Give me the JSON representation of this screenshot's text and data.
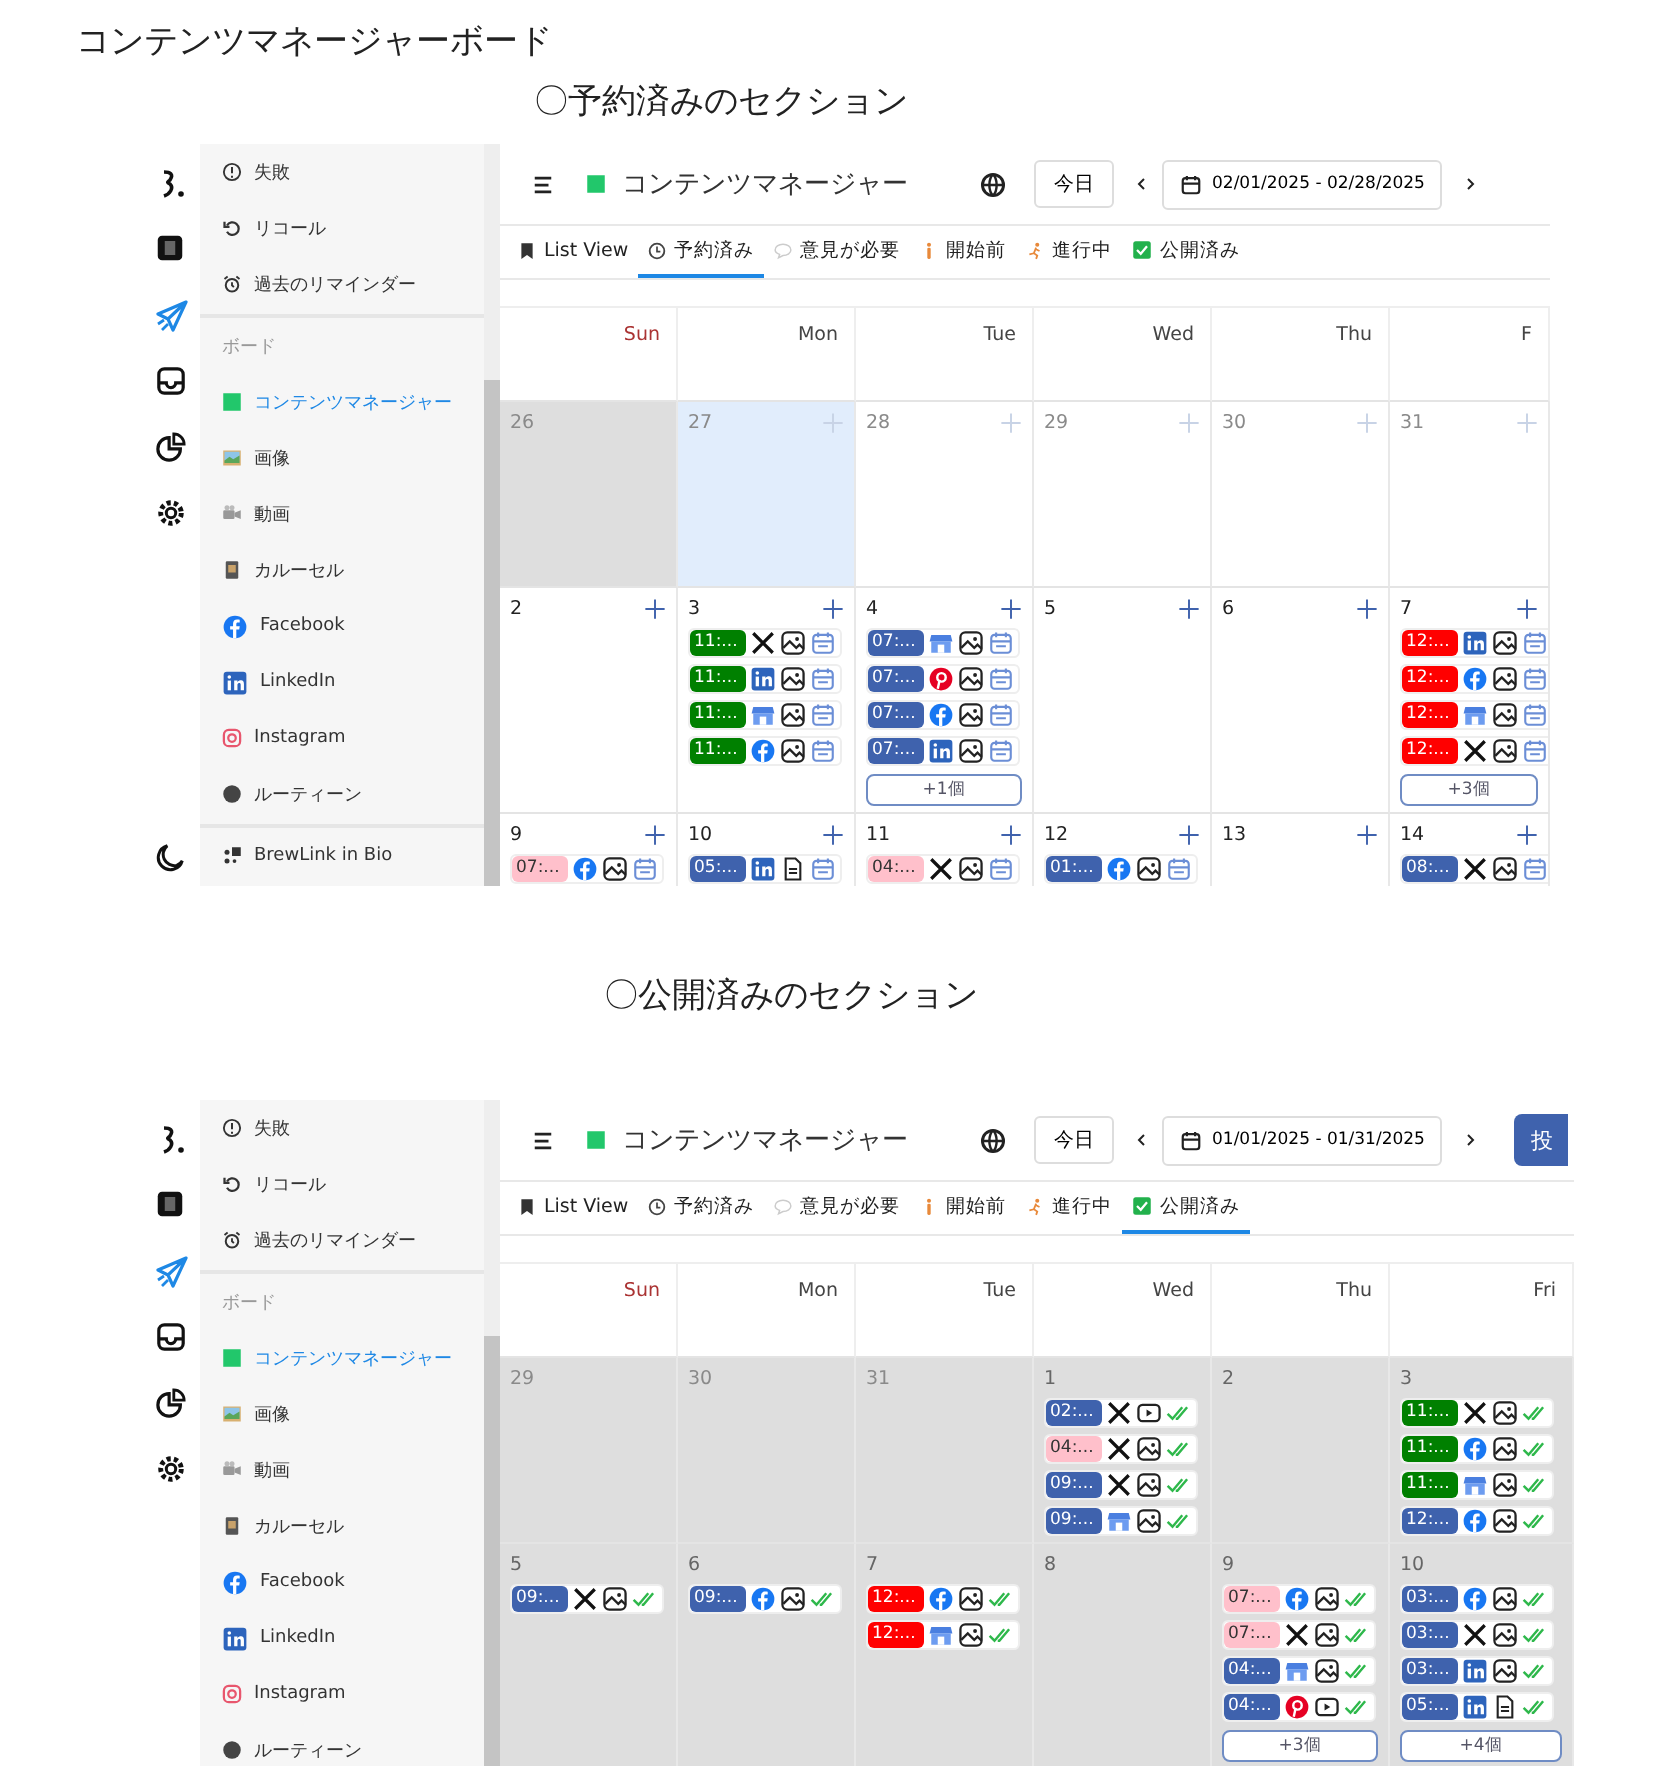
{
  "page_title": "コンテンツマネージャーボード",
  "sections": [
    {
      "heading": "〇予約済みのセクション",
      "panel": {
        "rail": [
          {
            "kind": "logo",
            "selected": false
          },
          {
            "kind": "notes",
            "selected": false
          },
          {
            "kind": "send",
            "selected": true
          },
          {
            "kind": "inbox",
            "selected": false
          },
          {
            "kind": "chart",
            "selected": false
          },
          {
            "kind": "settings",
            "selected": false
          },
          {
            "kind": "moon",
            "selected": false
          }
        ],
        "sidebar": [
          {
            "items": [
              {
                "kind": "alert",
                "label": "失敗",
                "selected": false
              },
              {
                "kind": "recall",
                "label": "リコール",
                "selected": false
              },
              {
                "kind": "alarm",
                "label": "過去のリマインダー",
                "selected": false
              }
            ]
          },
          {
            "label": "ボード",
            "items": [
              {
                "kind": "board",
                "label": "コンテンツマネージャー",
                "selected": true
              },
              {
                "kind": "image",
                "label": "画像",
                "selected": false
              },
              {
                "kind": "video",
                "label": "動画",
                "selected": false
              },
              {
                "kind": "carousel",
                "label": "カルーセル",
                "selected": false
              },
              {
                "kind": "facebook",
                "label": "Facebook",
                "selected": false
              },
              {
                "kind": "linkedin",
                "label": "LinkedIn",
                "selected": false
              },
              {
                "kind": "instagram",
                "label": "Instagram",
                "selected": false
              },
              {
                "kind": "routine",
                "label": "ルーティーン",
                "selected": false
              }
            ]
          },
          {
            "items": [
              {
                "kind": "brewlink",
                "label": "BrewLink in Bio",
                "selected": false
              }
            ]
          }
        ],
        "header": {
          "title": "コンテンツマネージャー",
          "today": "今日",
          "range": "02/01/2025 - 02/28/2025"
        },
        "tabs": [
          {
            "kind": "list",
            "label": "List View",
            "selected": false
          },
          {
            "kind": "scheduled",
            "label": "予約済み",
            "selected": true
          },
          {
            "kind": "feedback",
            "label": "意見が必要",
            "selected": false
          },
          {
            "kind": "not_started",
            "label": "開始前",
            "selected": false
          },
          {
            "kind": "in_progress",
            "label": "進行中",
            "selected": false
          },
          {
            "kind": "published",
            "label": "公開済み",
            "selected": false
          }
        ],
        "weekdays": [
          "Sun",
          "Mon",
          "Tue",
          "Wed",
          "Thu",
          "F"
        ],
        "weeks": [
          {
            "days": [
              {
                "day": "26",
                "other_month": true,
                "past": true,
                "today": false
              },
              {
                "day": "27",
                "other_month": true,
                "past": false,
                "today": true
              },
              {
                "day": "28",
                "other_month": true,
                "past": false,
                "today": false
              },
              {
                "day": "29",
                "other_month": true,
                "past": false,
                "today": false
              },
              {
                "day": "30",
                "other_month": true,
                "past": false,
                "today": false
              },
              {
                "day": "31",
                "other_month": true,
                "past": false,
                "today": false
              }
            ]
          },
          {
            "days": [
              {
                "day": "2",
                "other_month": false,
                "past": false,
                "today": false
              },
              {
                "day": "3",
                "other_month": false,
                "past": false,
                "today": false,
                "events": [
                  {
                    "time": "11:...",
                    "color": "#008000",
                    "kind": "x_image",
                    "published": false
                  },
                  {
                    "time": "11:...",
                    "color": "#008000",
                    "kind": "linkedin_image",
                    "published": false
                  },
                  {
                    "time": "11:...",
                    "color": "#008000",
                    "kind": "store_image",
                    "published": false
                  },
                  {
                    "time": "11:...",
                    "color": "#008000",
                    "kind": "facebook_image",
                    "published": false
                  }
                ]
              },
              {
                "day": "4",
                "other_month": false,
                "past": false,
                "today": false,
                "more": "+1個",
                "events": [
                  {
                    "time": "07:...",
                    "color": "#3f62ad",
                    "kind": "store_image",
                    "published": false
                  },
                  {
                    "time": "07:...",
                    "color": "#3f62ad",
                    "kind": "pinterest_image",
                    "published": false
                  },
                  {
                    "time": "07:...",
                    "color": "#3f62ad",
                    "kind": "facebook_image",
                    "published": false
                  },
                  {
                    "time": "07:...",
                    "color": "#3f62ad",
                    "kind": "linkedin_image",
                    "published": false
                  }
                ]
              },
              {
                "day": "5",
                "other_month": false,
                "past": false,
                "today": false
              },
              {
                "day": "6",
                "other_month": false,
                "past": false,
                "today": false
              },
              {
                "day": "7",
                "other_month": false,
                "past": false,
                "today": false,
                "more": "+3個",
                "events": [
                  {
                    "time": "12:...",
                    "color": "#ff0000",
                    "kind": "linkedin_image",
                    "published": false
                  },
                  {
                    "time": "12:...",
                    "color": "#ff0000",
                    "kind": "facebook_image",
                    "published": false
                  },
                  {
                    "time": "12:...",
                    "color": "#ff0000",
                    "kind": "store_image",
                    "published": false
                  },
                  {
                    "time": "12:...",
                    "color": "#ff0000",
                    "kind": "x_image",
                    "published": false
                  }
                ]
              }
            ]
          },
          {
            "days": [
              {
                "day": "9",
                "other_month": false,
                "past": false,
                "today": false,
                "events": [
                  {
                    "time": "07:...",
                    "color": "#ffc0cb",
                    "kind": "facebook_image",
                    "published": false
                  }
                ]
              },
              {
                "day": "10",
                "other_month": false,
                "past": false,
                "today": false,
                "events": [
                  {
                    "time": "05:...",
                    "color": "#3f62ad",
                    "kind": "linkedin_document",
                    "published": false
                  }
                ]
              },
              {
                "day": "11",
                "other_month": false,
                "past": false,
                "today": false,
                "events": [
                  {
                    "time": "04:...",
                    "color": "#ffc0cb",
                    "kind": "x_image",
                    "published": false
                  }
                ]
              },
              {
                "day": "12",
                "other_month": false,
                "past": false,
                "today": false,
                "events": [
                  {
                    "time": "01:...",
                    "color": "#3f62ad",
                    "kind": "facebook_image",
                    "published": false
                  }
                ]
              },
              {
                "day": "13",
                "other_month": false,
                "past": false,
                "today": false
              },
              {
                "day": "14",
                "other_month": false,
                "past": false,
                "today": false,
                "events": [
                  {
                    "time": "08:...",
                    "color": "#3f62ad",
                    "kind": "x_image",
                    "published": false
                  }
                ]
              }
            ]
          }
        ]
      }
    },
    {
      "heading": "〇公開済みのセクション",
      "panel": {
        "rail": [
          {
            "kind": "logo",
            "selected": false
          },
          {
            "kind": "notes",
            "selected": false
          },
          {
            "kind": "send",
            "selected": true
          },
          {
            "kind": "inbox",
            "selected": false
          },
          {
            "kind": "chart",
            "selected": false
          },
          {
            "kind": "settings",
            "selected": false
          }
        ],
        "sidebar": [
          {
            "items": [
              {
                "kind": "alert",
                "label": "失敗",
                "selected": false
              },
              {
                "kind": "recall",
                "label": "リコール",
                "selected": false
              },
              {
                "kind": "alarm",
                "label": "過去のリマインダー",
                "selected": false
              }
            ]
          },
          {
            "label": "ボード",
            "items": [
              {
                "kind": "board",
                "label": "コンテンツマネージャー",
                "selected": true
              },
              {
                "kind": "image",
                "label": "画像",
                "selected": false
              },
              {
                "kind": "video",
                "label": "動画",
                "selected": false
              },
              {
                "kind": "carousel",
                "label": "カルーセル",
                "selected": false
              },
              {
                "kind": "facebook",
                "label": "Facebook",
                "selected": false
              },
              {
                "kind": "linkedin",
                "label": "LinkedIn",
                "selected": false
              },
              {
                "kind": "instagram",
                "label": "Instagram",
                "selected": false
              },
              {
                "kind": "routine",
                "label": "ルーティーン",
                "selected": false
              }
            ]
          }
        ],
        "header": {
          "title": "コンテンツマネージャー",
          "today": "今日",
          "range": "01/01/2025 - 01/31/2025",
          "post_button": "投"
        },
        "tabs": [
          {
            "kind": "list",
            "label": "List View",
            "selected": false
          },
          {
            "kind": "scheduled",
            "label": "予約済み",
            "selected": false
          },
          {
            "kind": "feedback",
            "label": "意見が必要",
            "selected": false
          },
          {
            "kind": "not_started",
            "label": "開始前",
            "selected": false
          },
          {
            "kind": "in_progress",
            "label": "進行中",
            "selected": false
          },
          {
            "kind": "published",
            "label": "公開済み",
            "selected": true
          }
        ],
        "weekdays": [
          "Sun",
          "Mon",
          "Tue",
          "Wed",
          "Thu",
          "Fri"
        ],
        "weeks": [
          {
            "days": [
              {
                "day": "29",
                "other_month": true,
                "past": true,
                "today": false
              },
              {
                "day": "30",
                "other_month": true,
                "past": true,
                "today": false
              },
              {
                "day": "31",
                "other_month": true,
                "past": true,
                "today": false
              },
              {
                "day": "1",
                "other_month": false,
                "past": true,
                "today": false,
                "events": [
                  {
                    "time": "02:...",
                    "color": "#3f62ad",
                    "kind": "x_play",
                    "published": true
                  },
                  {
                    "time": "04:...",
                    "color": "#ffc0cb",
                    "kind": "x_image",
                    "published": true
                  },
                  {
                    "time": "09:...",
                    "color": "#3f62ad",
                    "kind": "x_image",
                    "published": true
                  },
                  {
                    "time": "09:...",
                    "color": "#3f62ad",
                    "kind": "store_image",
                    "published": true
                  }
                ]
              },
              {
                "day": "2",
                "other_month": false,
                "past": true,
                "today": false
              },
              {
                "day": "3",
                "other_month": false,
                "past": true,
                "today": false,
                "events": [
                  {
                    "time": "11:...",
                    "color": "#008000",
                    "kind": "x_image",
                    "published": true
                  },
                  {
                    "time": "11:...",
                    "color": "#008000",
                    "kind": "facebook_image",
                    "published": true
                  },
                  {
                    "time": "11:...",
                    "color": "#008000",
                    "kind": "store_image",
                    "published": true
                  },
                  {
                    "time": "12:...",
                    "color": "#3f62ad",
                    "kind": "facebook_image",
                    "published": true
                  }
                ]
              }
            ]
          },
          {
            "days": [
              {
                "day": "5",
                "other_month": false,
                "past": true,
                "today": false,
                "events": [
                  {
                    "time": "09:...",
                    "color": "#3f62ad",
                    "kind": "x_image",
                    "published": true
                  }
                ]
              },
              {
                "day": "6",
                "other_month": false,
                "past": true,
                "today": false,
                "events": [
                  {
                    "time": "09:...",
                    "color": "#3f62ad",
                    "kind": "facebook_image",
                    "published": true
                  }
                ]
              },
              {
                "day": "7",
                "other_month": false,
                "past": true,
                "today": false,
                "events": [
                  {
                    "time": "12:...",
                    "color": "#ff0000",
                    "kind": "facebook_image",
                    "published": true
                  },
                  {
                    "time": "12:...",
                    "color": "#ff0000",
                    "kind": "store_image",
                    "published": true
                  }
                ]
              },
              {
                "day": "8",
                "other_month": false,
                "past": true,
                "today": false
              },
              {
                "day": "9",
                "other_month": false,
                "past": true,
                "today": false,
                "more": "+3個",
                "events": [
                  {
                    "time": "07:...",
                    "color": "#ffc0cb",
                    "kind": "facebook_image",
                    "published": true
                  },
                  {
                    "time": "07:...",
                    "color": "#ffc0cb",
                    "kind": "x_image",
                    "published": true
                  },
                  {
                    "time": "04:...",
                    "color": "#3f62ad",
                    "kind": "store_image",
                    "published": true
                  },
                  {
                    "time": "04:...",
                    "color": "#3f62ad",
                    "kind": "pinterest_play",
                    "published": true
                  }
                ]
              },
              {
                "day": "10",
                "other_month": false,
                "past": true,
                "today": false,
                "more": "+4個",
                "events": [
                  {
                    "time": "03:...",
                    "color": "#3f62ad",
                    "kind": "facebook_image",
                    "published": true
                  },
                  {
                    "time": "03:...",
                    "color": "#3f62ad",
                    "kind": "x_image",
                    "published": true
                  },
                  {
                    "time": "03:...",
                    "color": "#3f62ad",
                    "kind": "linkedin_image",
                    "published": true
                  },
                  {
                    "time": "05:...",
                    "color": "#3f62ad",
                    "kind": "linkedin_document",
                    "published": true
                  }
                ]
              }
            ]
          }
        ]
      }
    }
  ]
}
